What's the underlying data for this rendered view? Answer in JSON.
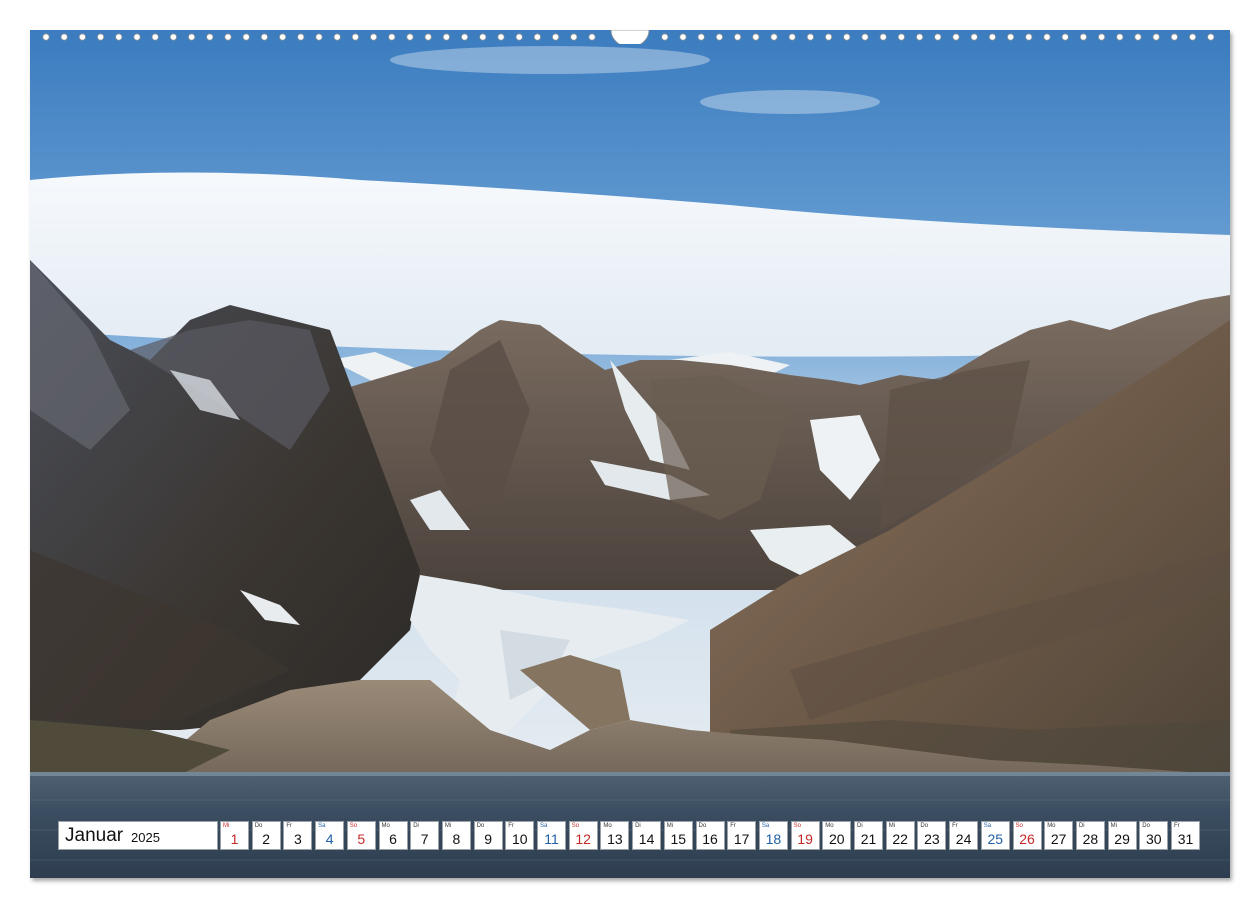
{
  "calendar": {
    "month": "Januar",
    "year": "2025",
    "days": [
      {
        "wd": "Mi",
        "d": "1",
        "kind": "hol"
      },
      {
        "wd": "Do",
        "d": "2",
        "kind": "wk"
      },
      {
        "wd": "Fr",
        "d": "3",
        "kind": "wk"
      },
      {
        "wd": "Sa",
        "d": "4",
        "kind": "sat"
      },
      {
        "wd": "So",
        "d": "5",
        "kind": "sun"
      },
      {
        "wd": "Mo",
        "d": "6",
        "kind": "wk"
      },
      {
        "wd": "Di",
        "d": "7",
        "kind": "wk"
      },
      {
        "wd": "Mi",
        "d": "8",
        "kind": "wk"
      },
      {
        "wd": "Do",
        "d": "9",
        "kind": "wk"
      },
      {
        "wd": "Fr",
        "d": "10",
        "kind": "wk"
      },
      {
        "wd": "Sa",
        "d": "11",
        "kind": "sat"
      },
      {
        "wd": "So",
        "d": "12",
        "kind": "sun"
      },
      {
        "wd": "Mo",
        "d": "13",
        "kind": "wk"
      },
      {
        "wd": "Di",
        "d": "14",
        "kind": "wk"
      },
      {
        "wd": "Mi",
        "d": "15",
        "kind": "wk"
      },
      {
        "wd": "Do",
        "d": "16",
        "kind": "wk"
      },
      {
        "wd": "Fr",
        "d": "17",
        "kind": "wk"
      },
      {
        "wd": "Sa",
        "d": "18",
        "kind": "sat"
      },
      {
        "wd": "So",
        "d": "19",
        "kind": "sun"
      },
      {
        "wd": "Mo",
        "d": "20",
        "kind": "wk"
      },
      {
        "wd": "Di",
        "d": "21",
        "kind": "wk"
      },
      {
        "wd": "Mi",
        "d": "22",
        "kind": "wk"
      },
      {
        "wd": "Do",
        "d": "23",
        "kind": "wk"
      },
      {
        "wd": "Fr",
        "d": "24",
        "kind": "wk"
      },
      {
        "wd": "Sa",
        "d": "25",
        "kind": "sat"
      },
      {
        "wd": "So",
        "d": "26",
        "kind": "sun"
      },
      {
        "wd": "Mo",
        "d": "27",
        "kind": "wk"
      },
      {
        "wd": "Di",
        "d": "28",
        "kind": "wk"
      },
      {
        "wd": "Mi",
        "d": "29",
        "kind": "wk"
      },
      {
        "wd": "Do",
        "d": "30",
        "kind": "wk"
      },
      {
        "wd": "Fr",
        "d": "31",
        "kind": "wk"
      }
    ]
  },
  "colors": {
    "saturday": "#1f5fa5",
    "sunday_holiday": "#c62828",
    "sky_top": "#3f7fc0",
    "water": "#3a4a5c"
  }
}
